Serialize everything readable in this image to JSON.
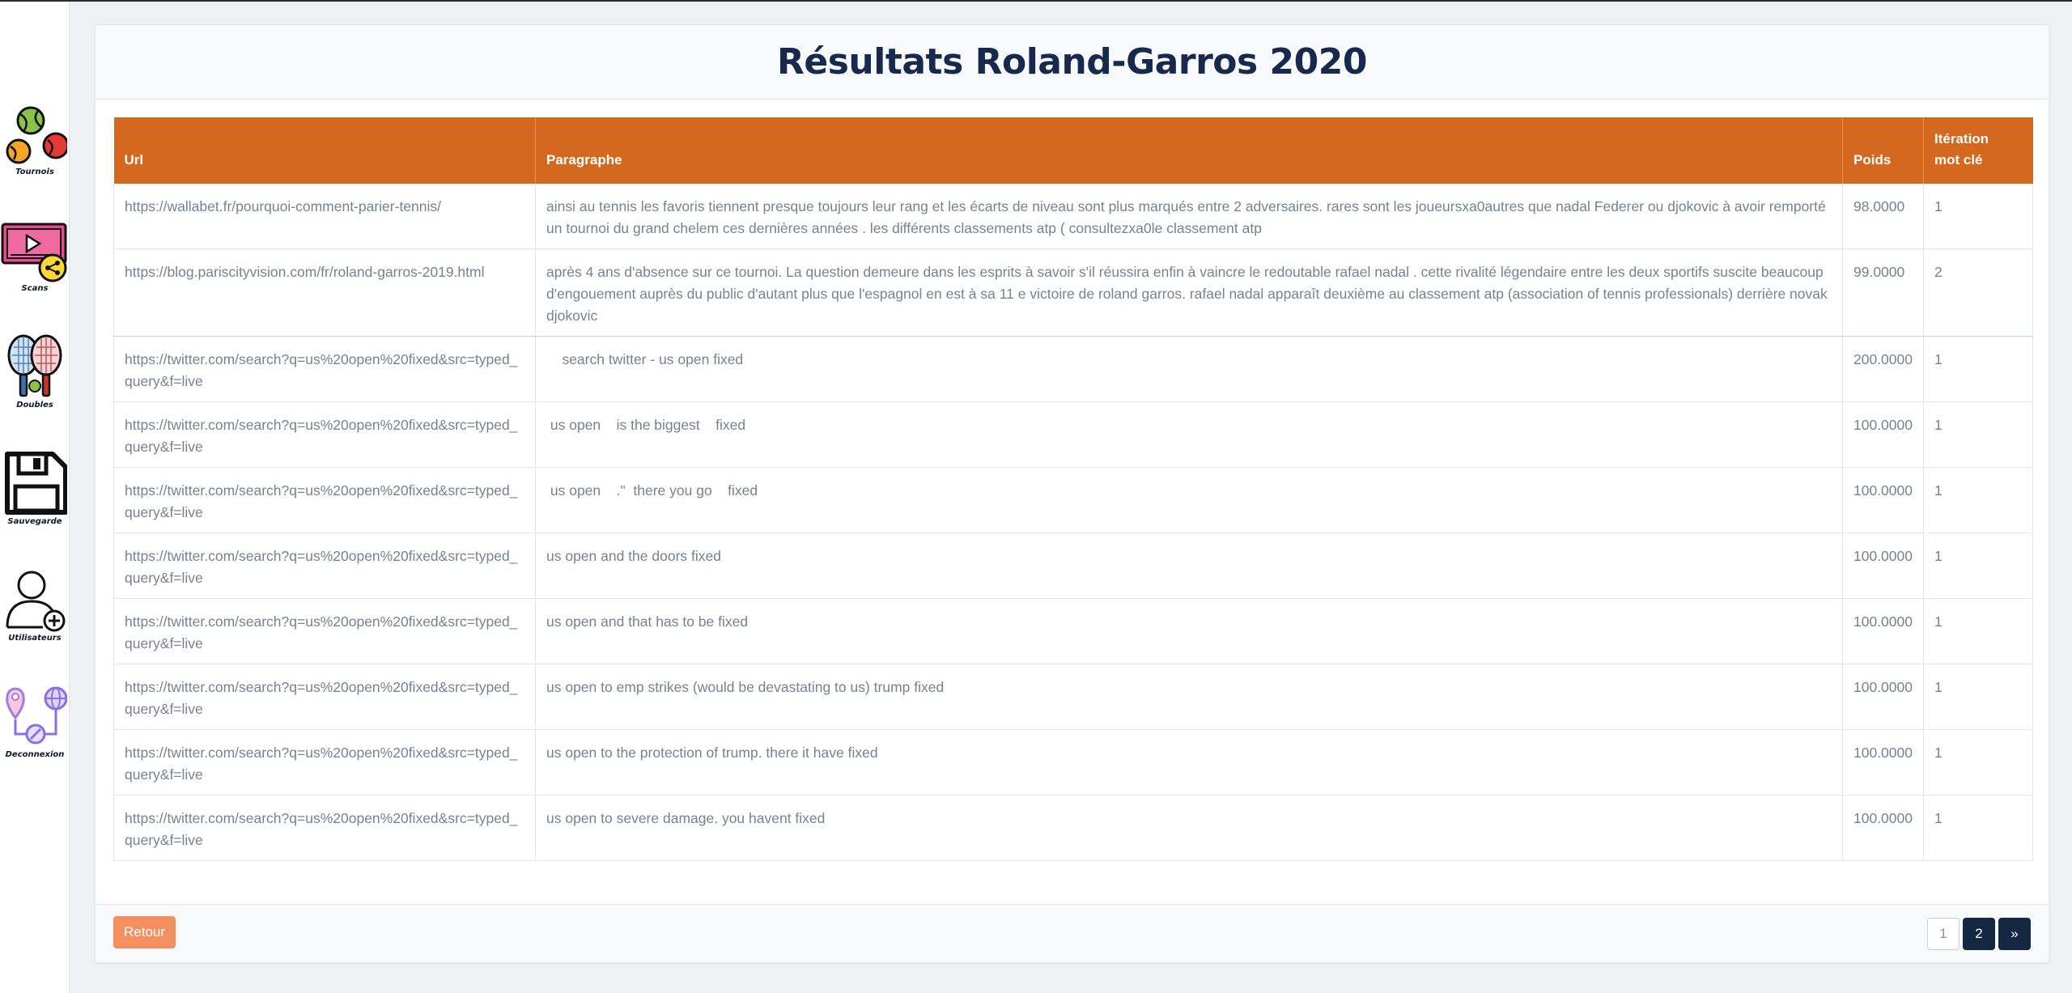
{
  "page": {
    "title": "Résultats Roland-Garros 2020"
  },
  "sidebar": {
    "items": [
      {
        "label": "Tournois",
        "icon": "tennis-balls-icon"
      },
      {
        "label": "Scans",
        "icon": "video-share-icon"
      },
      {
        "label": "Doubles",
        "icon": "tennis-rackets-icon"
      },
      {
        "label": "Sauvegarde",
        "icon": "floppy-disk-icon"
      },
      {
        "label": "Utilisateurs",
        "icon": "add-user-icon"
      },
      {
        "label": "Deconnexion",
        "icon": "location-network-icon"
      }
    ]
  },
  "table": {
    "headers": {
      "url": "Url",
      "paragraphe": "Paragraphe",
      "poids": "Poids",
      "iteration_line1": "Itération",
      "iteration_line2": "mot clé"
    },
    "rows": [
      {
        "url": "https://wallabet.fr/pourquoi-comment-parier-tennis/",
        "paragraphe": "ainsi au tennis les favoris tiennent presque toujours leur rang et les écarts de niveau sont plus marqués entre 2 adversaires. rares sont les joueursxa0autres que nadal Federer ou djokovic à avoir remporté un tournoi du grand chelem ces dernières années . les différents classements atp ( consultezxa0le classement atp",
        "poids": "98.0000",
        "iteration": "1"
      },
      {
        "url": "https://blog.pariscityvision.com/fr/roland-garros-2019.html",
        "paragraphe": "après 4 ans d'absence sur ce tournoi. La question demeure dans les esprits à savoir s'il réussira enfin à vaincre le redoutable rafael nadal . cette rivalité légendaire entre les deux sportifs suscite beaucoup d'engouement auprès du public d'autant plus que l'espagnol en est à sa 11 e victoire de roland garros. rafael nadal apparaît deuxième au classement atp (association of tennis professionals) derrière novak djokovic",
        "poids": "99.0000",
        "iteration": "2"
      },
      {
        "url": "https://twitter.com/search?q=us%20open%20fixed&src=typed_query&f=live",
        "paragraphe": "    search twitter - us open fixed",
        "poids": "200.0000",
        "iteration": "1"
      },
      {
        "url": "https://twitter.com/search?q=us%20open%20fixed&src=typed_query&f=live",
        "paragraphe": " us open    is the biggest    fixed",
        "poids": "100.0000",
        "iteration": "1"
      },
      {
        "url": "https://twitter.com/search?q=us%20open%20fixed&src=typed_query&f=live",
        "paragraphe": " us open    .\"  there you go    fixed",
        "poids": "100.0000",
        "iteration": "1"
      },
      {
        "url": "https://twitter.com/search?q=us%20open%20fixed&src=typed_query&f=live",
        "paragraphe": "us open and the doors fixed",
        "poids": "100.0000",
        "iteration": "1"
      },
      {
        "url": "https://twitter.com/search?q=us%20open%20fixed&src=typed_query&f=live",
        "paragraphe": "us open and that has to be fixed",
        "poids": "100.0000",
        "iteration": "1"
      },
      {
        "url": "https://twitter.com/search?q=us%20open%20fixed&src=typed_query&f=live",
        "paragraphe": "us open to emp strikes (would be devastating to us) trump fixed",
        "poids": "100.0000",
        "iteration": "1"
      },
      {
        "url": "https://twitter.com/search?q=us%20open%20fixed&src=typed_query&f=live",
        "paragraphe": "us open to the protection of trump. there it have fixed",
        "poids": "100.0000",
        "iteration": "1"
      },
      {
        "url": "https://twitter.com/search?q=us%20open%20fixed&src=typed_query&f=live",
        "paragraphe": "us open to severe damage. you havent fixed",
        "poids": "100.0000",
        "iteration": "1"
      }
    ]
  },
  "footer": {
    "back_label": "Retour",
    "pagination": {
      "pages": [
        "1",
        "2"
      ],
      "current": "2",
      "next_label": "»"
    }
  },
  "colors": {
    "header_orange": "#d4681f",
    "title_navy": "#17294d",
    "button_salmon": "#f4905f",
    "pager_active": "#142743"
  }
}
